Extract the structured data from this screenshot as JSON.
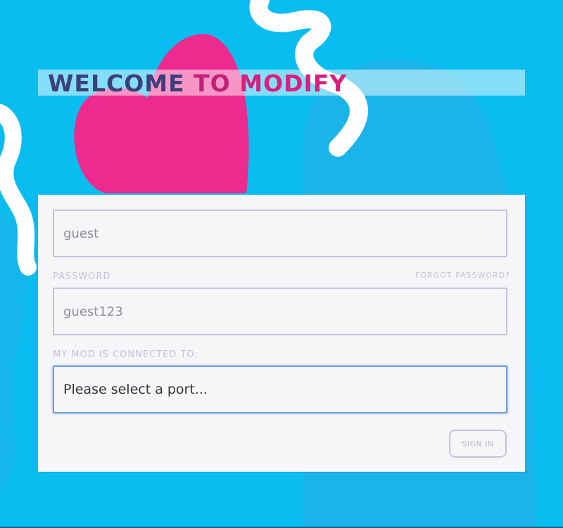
{
  "header": {
    "title_part1": "WELCOME ",
    "title_part2": "TO ",
    "title_part3": "MODIFY"
  },
  "form": {
    "username_value": "guest",
    "password_label": "PASSWORD",
    "forgot_password_label": "FORGOT PASSWORD?",
    "password_value": "guest123",
    "port_label": "MY MOD IS CONNECTED TO:",
    "port_value": "Please select a port...",
    "signin_label": "SIGN IN"
  },
  "colors": {
    "background": "#0ABDF1",
    "heart": "#EE2A8E",
    "title_dark": "#3C3F7A",
    "title_pink": "#D81F7E",
    "focus_border": "#6F9EE0"
  }
}
